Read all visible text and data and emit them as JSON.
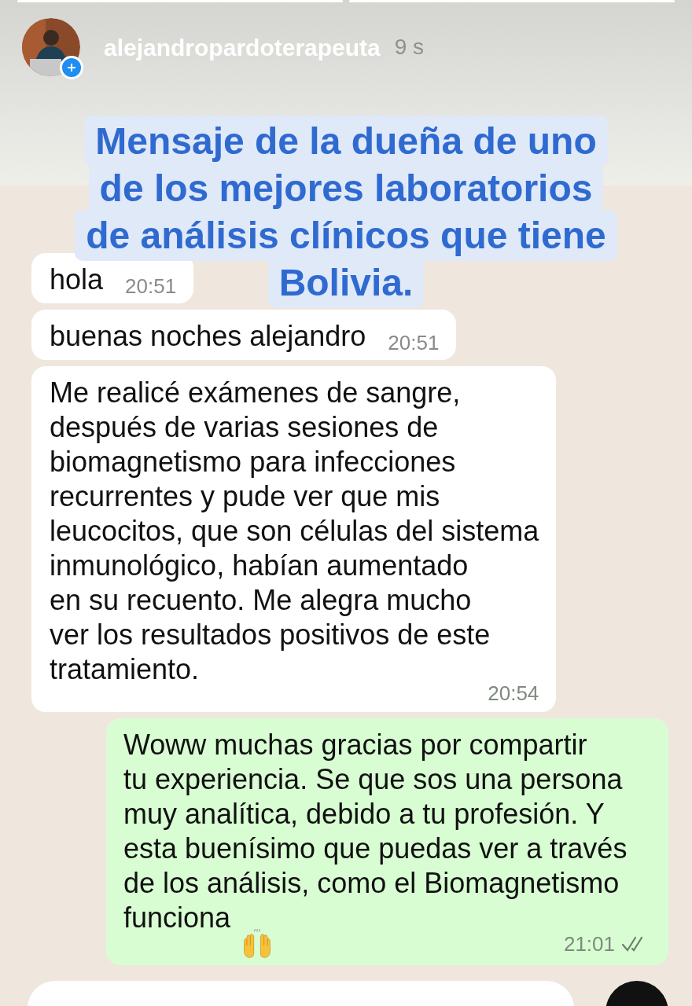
{
  "story": {
    "progress": [
      {
        "level": 1
      },
      {
        "level": 1
      }
    ],
    "username": "alejandropardoterapeuta",
    "time": "9 s"
  },
  "caption": "Mensaje de la dueña de uno\nde los mejores laboratorios\nde análisis clínicos que tiene\nBolivia.",
  "messages": [
    {
      "kind": "received",
      "text": "hola",
      "time": "20:51"
    },
    {
      "kind": "received",
      "text": "buenas noches alejandro",
      "time": "20:51"
    },
    {
      "kind": "received",
      "text": "Me realicé exámenes de sangre,\ndespués de varias sesiones de\nbiomagnetismo para infecciones\nrecurrentes  y pude ver  que mis\nleucocitos, que son células del sistema\ninmunológico, habían aumentado\nen su recuento. Me alegra mucho\nver los resultados positivos de este\ntratamiento.",
      "time": "20:54"
    },
    {
      "kind": "sent",
      "text": "Woww muchas gracias por compartir\ntu experiencia. Se que sos una persona\nmuy analítica, debido a tu profesión. Y\nesta buenísimo que puedas ver a través\nde los análisis, como el Biomagnetismo\nfunciona",
      "time": "21:01",
      "read": true
    }
  ]
}
